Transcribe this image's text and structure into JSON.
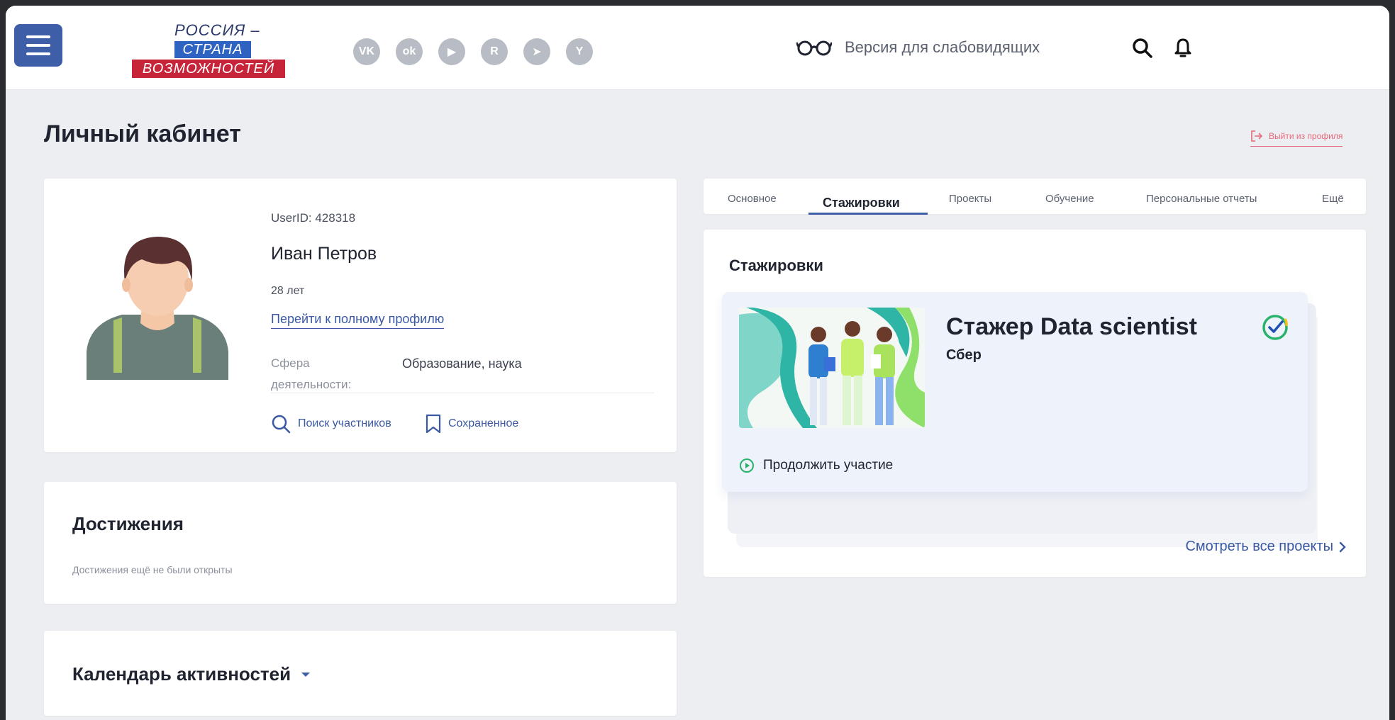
{
  "header": {
    "logo": {
      "line1": "РОССИЯ –",
      "line2": "СТРАНА",
      "line3": "ВОЗМОЖНОСТЕЙ"
    },
    "socials": [
      {
        "icon": "vk-icon",
        "glyph": "VK"
      },
      {
        "icon": "odnoklassniki-icon",
        "glyph": "ok"
      },
      {
        "icon": "youtube-icon",
        "glyph": "▶"
      },
      {
        "icon": "rutube-icon",
        "glyph": "R"
      },
      {
        "icon": "telegram-icon",
        "glyph": "➤"
      },
      {
        "icon": "yandex-zen-icon",
        "glyph": "Y"
      }
    ],
    "vision_label": "Версия для слабовидящих"
  },
  "page": {
    "title": "Личный кабинет",
    "logout_label": "Выйти из профиля"
  },
  "profile": {
    "user_id": "UserID: 428318",
    "name": "Иван Петров",
    "age": "28 лет",
    "full_profile_link": "Перейти к полному профилю",
    "sphere_label": "Сфера деятельности:",
    "sphere_value": "Образование, наука",
    "search_label": "Поиск участников",
    "saved_label": "Сохраненное"
  },
  "achievements": {
    "title": "Достижения",
    "empty_text": "Достижения ещё не были открыты"
  },
  "calendar": {
    "title": "Календарь активностей"
  },
  "tabs": [
    {
      "label": "Основное",
      "active": false
    },
    {
      "label": "Стажировки",
      "active": true
    },
    {
      "label": "Проекты",
      "active": false
    },
    {
      "label": "Обучение",
      "active": false
    },
    {
      "label": "Персональные отчеты",
      "active": false
    },
    {
      "label": "Ещё",
      "active": false
    }
  ],
  "internships": {
    "title": "Стажировки",
    "card": {
      "title": "Стажер Data scientist",
      "company": "Сбер",
      "continue_label": "Продолжить участие"
    },
    "see_all_label": "Смотреть все проекты"
  },
  "colors": {
    "accent": "#3f5ea8",
    "logout": "#e76a7c",
    "check": "#27b36a"
  }
}
